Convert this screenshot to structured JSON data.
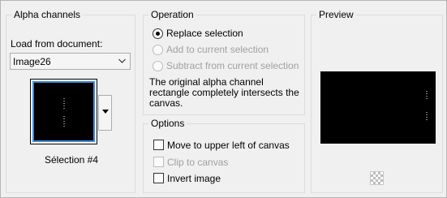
{
  "alpha": {
    "title": "Alpha channels",
    "load_label": "Load from document:",
    "document_selected": "Image26",
    "thumbnail_caption": "Sélection #4"
  },
  "operation": {
    "title": "Operation",
    "options": [
      {
        "label": "Replace selection",
        "selected": true,
        "enabled": true
      },
      {
        "label": "Add to current selection",
        "selected": false,
        "enabled": false
      },
      {
        "label": "Subtract from current selection",
        "selected": false,
        "enabled": false
      }
    ],
    "note": "The original alpha channel rectangle completely intersects the canvas."
  },
  "options": {
    "title": "Options",
    "items": [
      {
        "label": "Move to upper left of canvas",
        "checked": false,
        "enabled": true
      },
      {
        "label": "Clip to canvas",
        "checked": false,
        "enabled": false
      },
      {
        "label": "Invert image",
        "checked": false,
        "enabled": true
      }
    ]
  },
  "preview": {
    "title": "Preview"
  },
  "colors": {
    "accent": "#3c8ad8",
    "panel": "#f0f0f0"
  }
}
